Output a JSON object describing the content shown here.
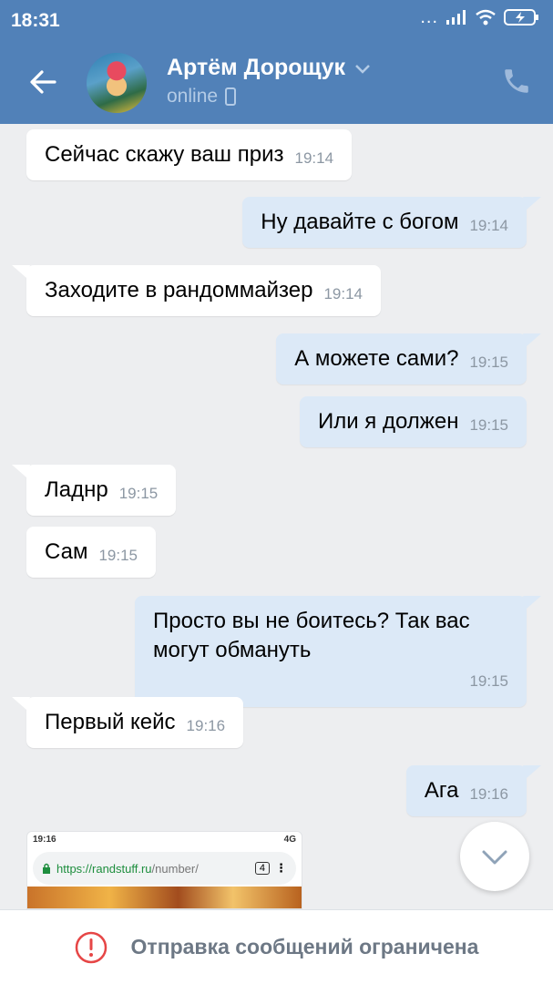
{
  "status_bar": {
    "time": "18:31",
    "dots": "...",
    "battery_icon": "battery-charging-icon",
    "signal_icon": "signal-icon",
    "wifi_icon": "wifi-icon"
  },
  "header": {
    "name": "Артём Дорощук",
    "presence": "online",
    "back_icon": "arrow-left-icon",
    "call_icon": "phone-icon",
    "chevron_icon": "chevron-down-icon",
    "mobile_icon": "mobile-device-icon"
  },
  "messages": [
    {
      "side": "in",
      "text": "Сейчас скажу ваш приз",
      "time": "19:14"
    },
    {
      "side": "out",
      "text": "Ну давайте с богом",
      "time": "19:14"
    },
    {
      "side": "in",
      "text": "Заходите в рандоммайзер",
      "time": "19:14"
    },
    {
      "side": "out",
      "text": "А можете сами?",
      "time": "19:15"
    },
    {
      "side": "out",
      "text": "Или я должен",
      "time": "19:15"
    },
    {
      "side": "in",
      "text": "Ладнр",
      "time": "19:15"
    },
    {
      "side": "in",
      "text": "Сам",
      "time": "19:15"
    },
    {
      "side": "out",
      "text": "Просто вы не боитесь? Так вас могут обмануть",
      "time": "19:15"
    },
    {
      "side": "in",
      "text": "Первый кейс",
      "time": "19:16"
    },
    {
      "side": "out",
      "text": "Ага",
      "time": "19:16"
    }
  ],
  "attachment_preview": {
    "time": "19:16",
    "status_right": "4G",
    "url_host": "https://randstuff.ru",
    "url_path": "/number/",
    "tabs_count": "4"
  },
  "footer": {
    "text": "Отправка сообщений ограничена",
    "icon": "alert-circle-icon"
  },
  "colors": {
    "header_bg": "#5181b8",
    "outgoing_bubble": "#dce9f7",
    "incoming_bubble": "#ffffff",
    "alert_red": "#e64646"
  }
}
